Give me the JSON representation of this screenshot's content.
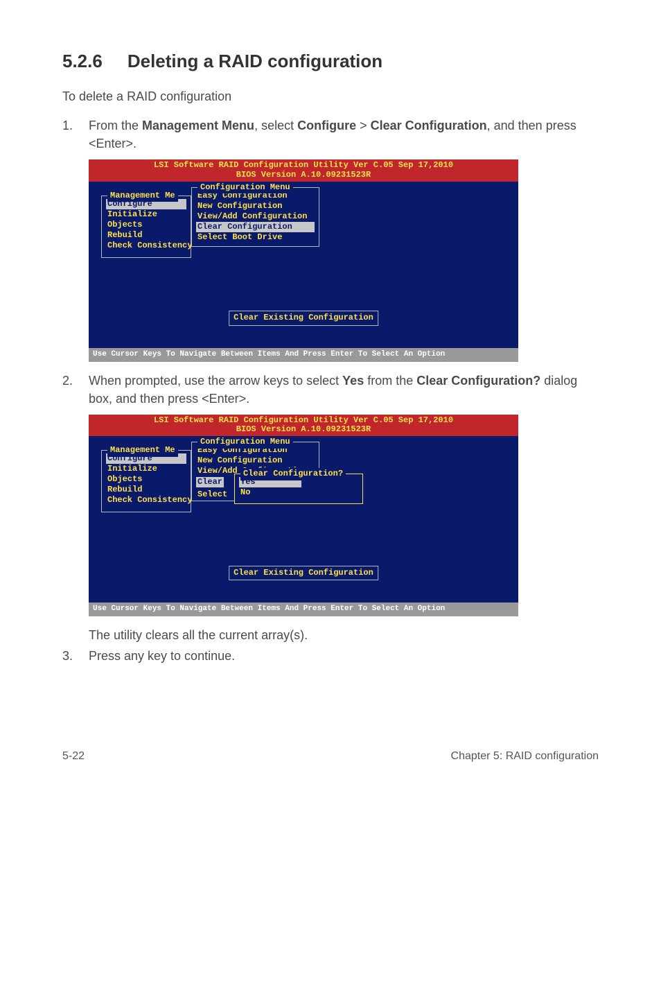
{
  "heading": {
    "num": "5.2.6",
    "title": "Deleting a RAID configuration"
  },
  "intro": "To delete a RAID configuration",
  "steps": {
    "s1_p1": "From the ",
    "s1_b1": "Management Menu",
    "s1_p2": ", select ",
    "s1_b2": "Configure",
    "s1_gt": " > ",
    "s1_b3": "Clear Configuration",
    "s1_p3": ", and then press <Enter>.",
    "s2_p1": "When prompted, use the arrow keys to select ",
    "s2_b1": "Yes",
    "s2_p2": " from the ",
    "s2_b2": "Clear Configuration?",
    "s2_p3": " dialog box, and then press <Enter>.",
    "note": "The utility clears all the current array(s).",
    "s3": "Press any key to continue."
  },
  "bios": {
    "title1": "LSI Software RAID Configuration Utility Ver C.05 Sep 17,2010",
    "title2": "BIOS Version  A.10.09231523R",
    "mgmt_title": "Management Me",
    "mgmt": [
      "Configure",
      "Initialize",
      "Objects",
      "Rebuild",
      "Check Consistency"
    ],
    "cfg_title": "Configuration Menu",
    "cfg_items": [
      "Easy Configuration",
      "New Configuration",
      "View/Add Configuration",
      "Clear Configuration",
      "Select Boot Drive"
    ],
    "cfg2_items": [
      "Easy Configuration",
      "New Configuration",
      "View/Add Configuration",
      "Clear",
      "Select"
    ],
    "confirm_title": "Clear Configuration?",
    "confirm_yes": "Yes",
    "confirm_no": "No",
    "status": "Clear Existing Configuration",
    "footer": "Use Cursor Keys To Navigate Between Items And Press Enter To Select An Option"
  },
  "page": {
    "left": "5-22",
    "right": "Chapter 5: RAID configuration"
  }
}
